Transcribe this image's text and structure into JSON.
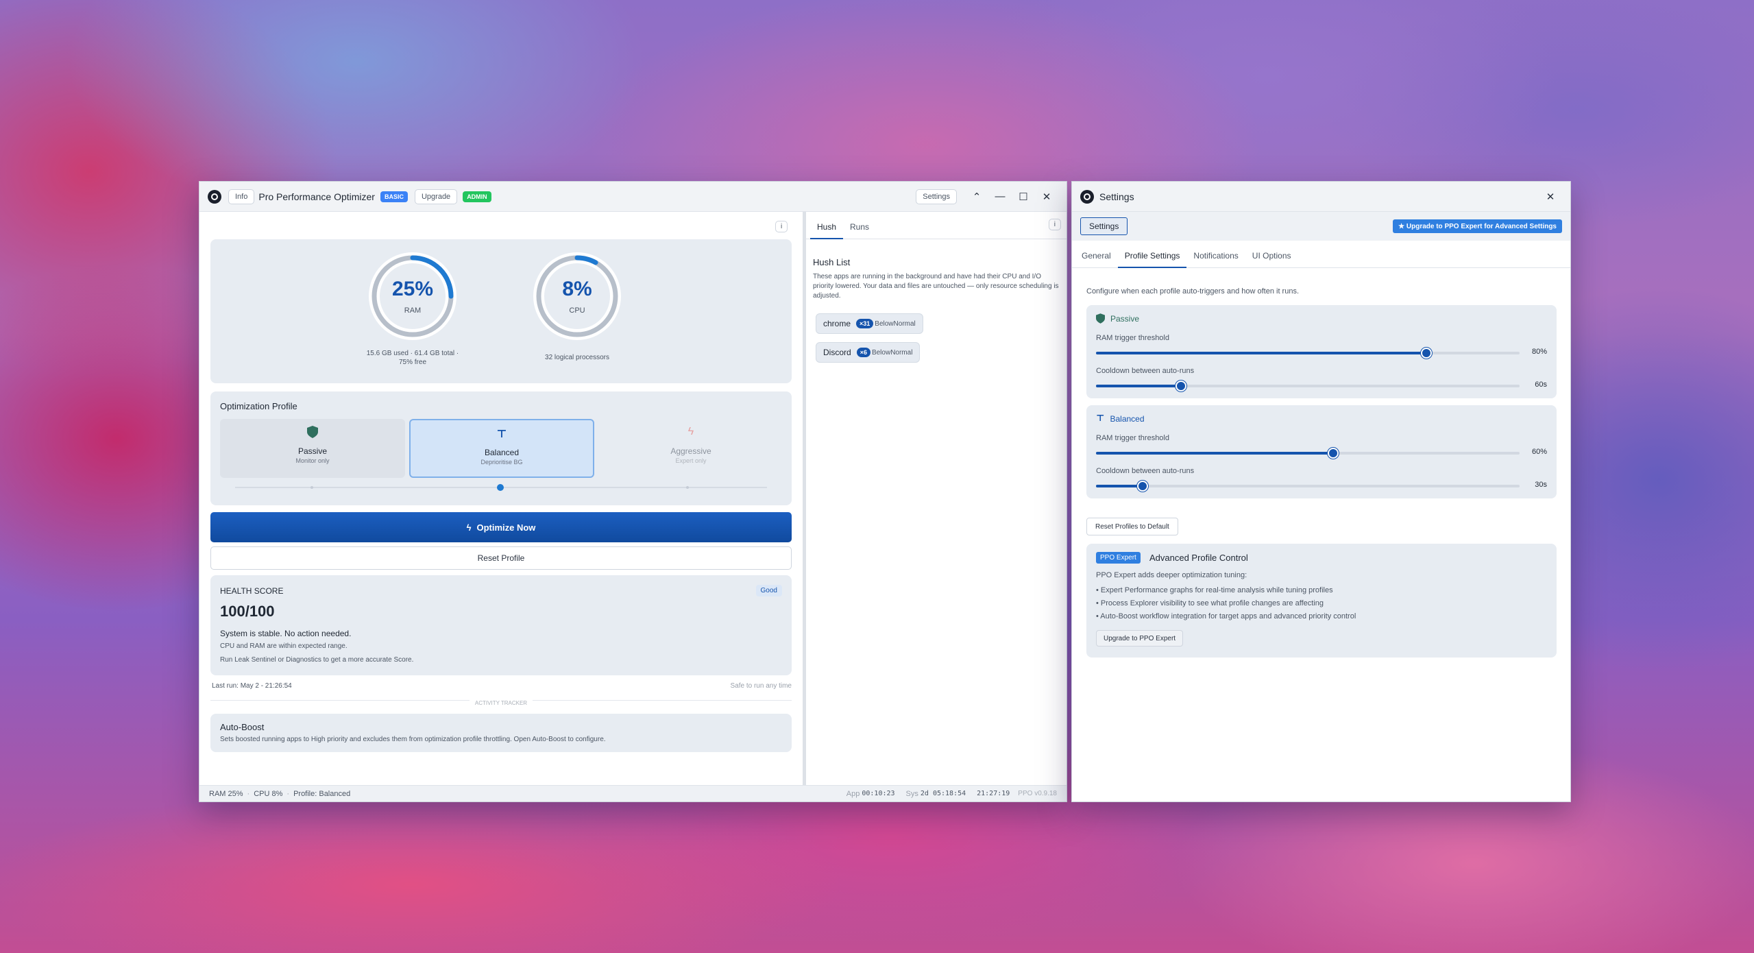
{
  "main": {
    "info_label": "Info",
    "title": "Pro Performance Optimizer",
    "tier_badge": "BASIC",
    "upgrade_label": "Upgrade",
    "admin_badge": "ADMIN",
    "settings_label": "Settings",
    "info_small": "i",
    "gauges": {
      "ram": {
        "value": "25%",
        "label": "RAM",
        "fill": 0.25,
        "detail1": "15.6 GB used · 61.4 GB total ·",
        "detail2": "75% free"
      },
      "cpu": {
        "value": "8%",
        "label": "CPU",
        "fill": 0.08,
        "detail1": "32 logical processors"
      }
    },
    "optimization": {
      "title": "Optimization Profile",
      "profiles": [
        {
          "name": "Passive",
          "sub": "Monitor only"
        },
        {
          "name": "Balanced",
          "sub": "Deprioritise BG"
        },
        {
          "name": "Aggressive",
          "sub": "Expert only"
        }
      ]
    },
    "optimize_label": "Optimize Now",
    "reset_label": "Reset Profile",
    "health": {
      "title": "HEALTH SCORE",
      "badge": "Good",
      "score": "100/100",
      "status": "System is stable. No action needed.",
      "line1": "CPU and RAM are within expected range.",
      "line2": "Run Leak Sentinel or Diagnostics to get a more accurate Score."
    },
    "last_run": "Last run: May 2 - 21:26:54",
    "safe_text": "Safe to run any time",
    "activity_label": "ACTIVITY TRACKER",
    "autoboost": {
      "title": "Auto-Boost",
      "desc": "Sets boosted running apps to High priority and excludes them from optimization profile throttling. Open Auto-Boost to configure."
    },
    "hush": {
      "tabs": [
        "Hush",
        "Runs"
      ],
      "title": "Hush List",
      "desc": "These apps are running in the background and have had their CPU and I/O priority lowered. Your data and files are untouched — only resource scheduling is adjusted.",
      "items": [
        {
          "name": "chrome",
          "count": "×31",
          "prio": "BelowNormal"
        },
        {
          "name": "Discord",
          "count": "×6",
          "prio": "BelowNormal"
        }
      ]
    },
    "status": {
      "ram": "RAM 25%",
      "cpu": "CPU 8%",
      "profile": "Profile: Balanced",
      "app_label": "App",
      "app_time": "00:10:23",
      "sys_label": "Sys",
      "sys_time": "2d 05:18:54",
      "clock": "21:27:19",
      "version": "PPO v0.9.18"
    }
  },
  "settings": {
    "title": "Settings",
    "settings_chip": "Settings",
    "upgrade_banner": "★ Upgrade to PPO Expert for Advanced Settings",
    "tabs": [
      "General",
      "Profile Settings",
      "Notifications",
      "UI Options"
    ],
    "intro": "Configure when each profile auto-triggers and how often it runs.",
    "profiles": [
      {
        "name": "Passive",
        "ram_label": "RAM trigger threshold",
        "ram_value": "80%",
        "ram_fill": 0.78,
        "cool_label": "Cooldown between auto-runs",
        "cool_value": "60s",
        "cool_fill": 0.2
      },
      {
        "name": "Balanced",
        "ram_label": "RAM trigger threshold",
        "ram_value": "60%",
        "ram_fill": 0.56,
        "cool_label": "Cooldown between auto-runs",
        "cool_value": "30s",
        "cool_fill": 0.11
      }
    ],
    "reset_label": "Reset Profiles to Default",
    "expert": {
      "badge": "PPO Expert",
      "title": "Advanced Profile Control",
      "intro": "PPO Expert adds deeper optimization tuning:",
      "bullets": [
        "• Expert Performance graphs for real-time analysis while tuning profiles",
        "• Process Explorer visibility to see what profile changes are affecting",
        "• Auto-Boost workflow integration for target apps and advanced priority control"
      ],
      "button": "Upgrade to PPO Expert"
    }
  },
  "colors": {
    "accent": "#1554ad",
    "basic_badge": "#3b82f6",
    "admin_badge": "#22c55e",
    "passive_icon": "#2f6f5e",
    "aggressive_icon": "#e6a0a0"
  }
}
